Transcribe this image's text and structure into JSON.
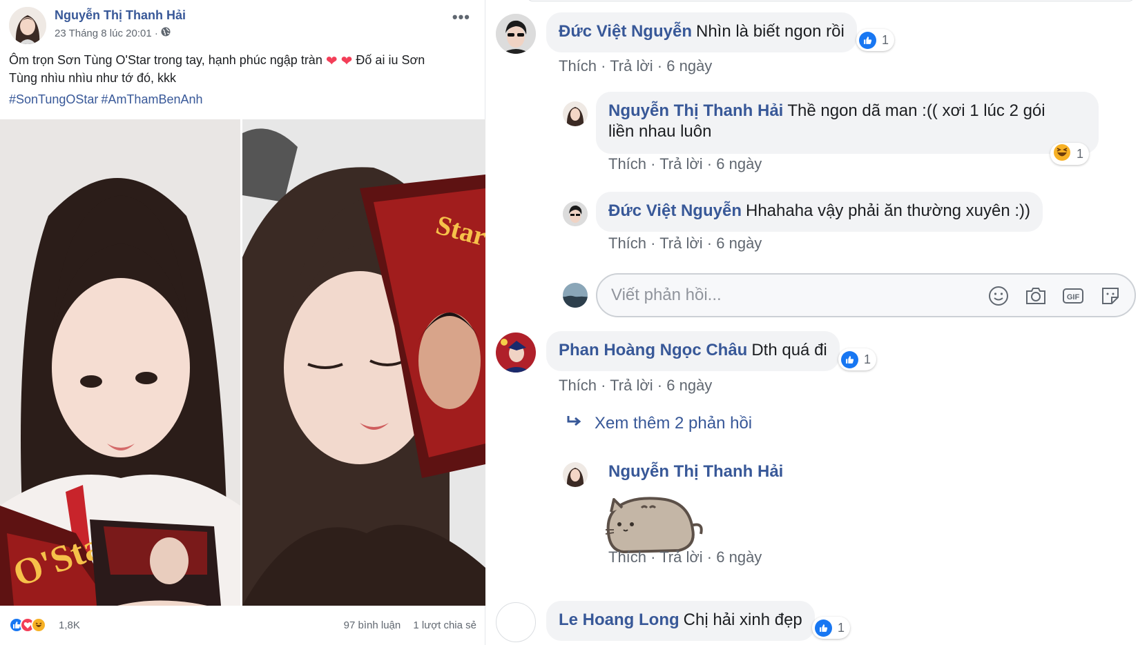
{
  "post": {
    "author": "Nguyễn Thị Thanh Hải",
    "time": "23 Tháng 8 lúc 20:01 ·",
    "more_label": "•••",
    "text_part1": "Ôm trọn Sơn Tùng O'Star trong tay, hạnh phúc ngập tràn",
    "text_part2": "Đố ai iu Sơn",
    "text_part3": "Tùng nhìu nhìu như tớ đó, kkk",
    "hashtags": [
      "#SonTungOStar",
      "#AmThamBenAnh"
    ],
    "reaction_count": "1,8K",
    "comments_count": "97 bình luận",
    "shares_count": "1 lượt chia sẻ"
  },
  "comments": [
    {
      "name": "Đức Việt Nguyễn",
      "text": "Nhìn là biết ngon rồi",
      "like": "Thích",
      "reply": "Trả lời",
      "time": "6 ngày",
      "reaction_count": "1"
    },
    {
      "name": "Nguyễn Thị Thanh Hải",
      "text_line1": "Thề ngon dã man :(( xơi 1 lúc 2 gói",
      "text_line2": "liền nhau luôn",
      "like": "Thích",
      "reply": "Trả lời",
      "time": "6 ngày",
      "reaction_count": "1"
    },
    {
      "name": "Đức Việt Nguyễn",
      "text": "Hhahaha vậy phải ăn thường xuyên :))",
      "like": "Thích",
      "reply": "Trả lời",
      "time": "6 ngày"
    },
    {
      "name": "Phan Hoàng Ngọc Châu",
      "text": "Dth quá đi",
      "like": "Thích",
      "reply": "Trả lời",
      "time": "6 ngày",
      "reaction_count": "1"
    },
    {
      "name": "Nguyễn Thị Thanh Hải",
      "like": "Thích",
      "reply": "Trả lời",
      "time": "6 ngày"
    },
    {
      "name": "Le Hoang Long",
      "text": "Chị hải xinh đẹp",
      "reaction_count": "1"
    }
  ],
  "reply_input": {
    "placeholder": "Viết phản hồi..."
  },
  "more_replies": "Xem thêm 2 phản hồi",
  "colors": {
    "link": "#385898",
    "like_blue": "#1877f2",
    "love_red": "#f33e58",
    "bubble_bg": "#f2f3f5"
  }
}
